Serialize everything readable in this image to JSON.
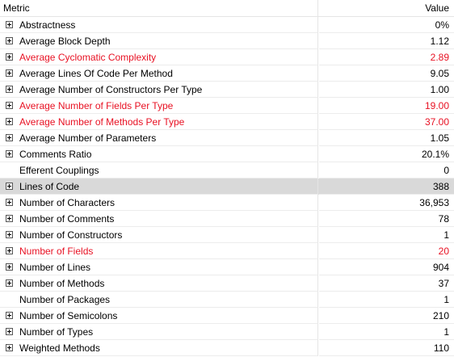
{
  "header": {
    "metric": "Metric",
    "value": "Value"
  },
  "colors": {
    "highlight": "#e81123",
    "selected_row": "#d9d9d9"
  },
  "rows": [
    {
      "name": "Abstractness",
      "value": "0%",
      "expandable": true,
      "highlight": false
    },
    {
      "name": "Average Block Depth",
      "value": "1.12",
      "expandable": true,
      "highlight": false
    },
    {
      "name": "Average Cyclomatic Complexity",
      "value": "2.89",
      "expandable": true,
      "highlight": true
    },
    {
      "name": "Average Lines Of Code Per Method",
      "value": "9.05",
      "expandable": true,
      "highlight": false
    },
    {
      "name": "Average Number of Constructors Per Type",
      "value": "1.00",
      "expandable": true,
      "highlight": false
    },
    {
      "name": "Average Number of Fields Per Type",
      "value": "19.00",
      "expandable": true,
      "highlight": true
    },
    {
      "name": "Average Number of Methods Per Type",
      "value": "37.00",
      "expandable": true,
      "highlight": true
    },
    {
      "name": "Average Number of Parameters",
      "value": "1.05",
      "expandable": true,
      "highlight": false
    },
    {
      "name": "Comments Ratio",
      "value": "20.1%",
      "expandable": true,
      "highlight": false
    },
    {
      "name": "Efferent Couplings",
      "value": "0",
      "expandable": false,
      "highlight": false
    },
    {
      "name": "Lines of Code",
      "value": "388",
      "expandable": true,
      "highlight": false,
      "selected": true
    },
    {
      "name": "Number of Characters",
      "value": "36,953",
      "expandable": true,
      "highlight": false
    },
    {
      "name": "Number of Comments",
      "value": "78",
      "expandable": true,
      "highlight": false
    },
    {
      "name": "Number of Constructors",
      "value": "1",
      "expandable": true,
      "highlight": false
    },
    {
      "name": "Number of Fields",
      "value": "20",
      "expandable": true,
      "highlight": true
    },
    {
      "name": "Number of Lines",
      "value": "904",
      "expandable": true,
      "highlight": false
    },
    {
      "name": "Number of Methods",
      "value": "37",
      "expandable": true,
      "highlight": false
    },
    {
      "name": "Number of Packages",
      "value": "1",
      "expandable": false,
      "highlight": false
    },
    {
      "name": "Number of Semicolons",
      "value": "210",
      "expandable": true,
      "highlight": false
    },
    {
      "name": "Number of Types",
      "value": "1",
      "expandable": true,
      "highlight": false
    },
    {
      "name": "Weighted Methods",
      "value": "110",
      "expandable": true,
      "highlight": false
    }
  ]
}
